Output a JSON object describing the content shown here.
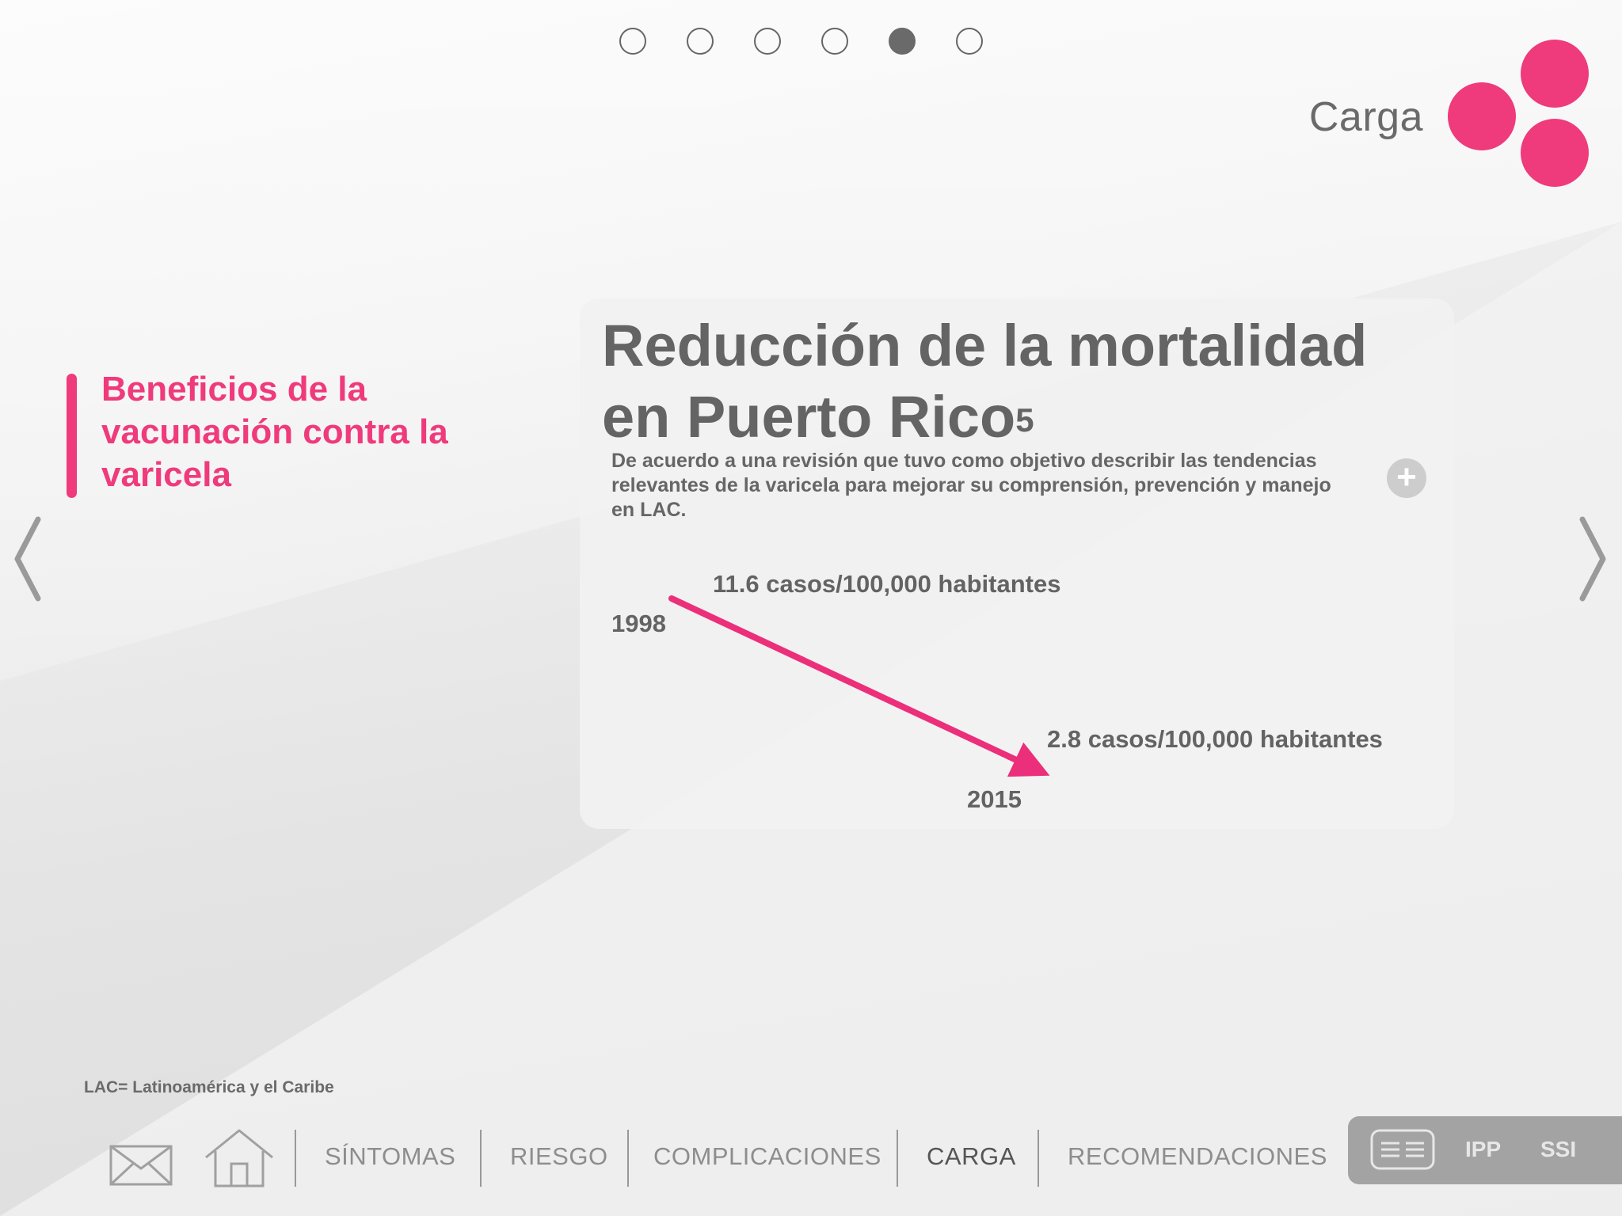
{
  "pager": {
    "total": 6,
    "active_index": 4
  },
  "section": {
    "title": "Carga",
    "accent": "#ef3a7c"
  },
  "sidebar": {
    "heading": "Beneficios de la vacunación contra la varicela"
  },
  "card": {
    "title_line1": "Reducción de la mortalidad",
    "title_line2": "en Puerto Rico",
    "title_ref": "5",
    "description": "De acuerdo a una revisión que tuvo como objetivo describir las tendencias relevantes de la varicela para mejorar su comprensión, prevención y manejo en LAC.",
    "more_button": "+"
  },
  "chart_data": {
    "type": "line",
    "x": [
      "1998",
      "2015"
    ],
    "series": [
      {
        "values": [
          11.6,
          2.8
        ]
      }
    ],
    "data_labels": [
      "11.6 casos/100,000 habitantes",
      "2.8 casos/100,000 habitantes"
    ],
    "color": "#ec2f7a"
  },
  "footnote": "LAC= Latinoamérica y el Caribe",
  "nav": {
    "icons": [
      "mail-icon",
      "home-icon"
    ],
    "items": [
      "SÍNTOMAS",
      "RIESGO",
      "COMPLICACIONES",
      "CARGA",
      "RECOMENDACIONES"
    ],
    "active": "CARGA",
    "panel": {
      "ipp": "IPP",
      "ssi": "SSI"
    }
  }
}
